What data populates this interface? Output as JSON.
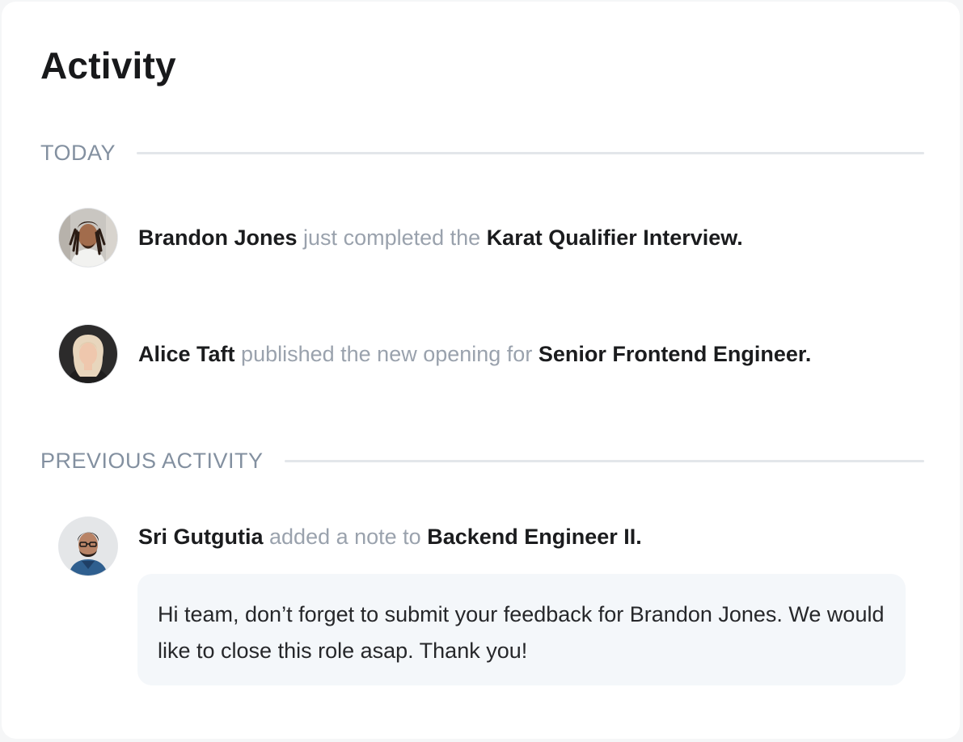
{
  "header": {
    "title": "Activity"
  },
  "sections": {
    "today": {
      "label": "TODAY",
      "items": [
        {
          "name": "Brandon Jones",
          "verb": "just completed the",
          "target": "Karat Qualifier Interview.",
          "avatar_icon": "person-photo-icon"
        },
        {
          "name": "Alice Taft",
          "verb": "published the new opening for",
          "target": "Senior Frontend Engineer.",
          "avatar_icon": "person-photo-icon"
        }
      ]
    },
    "previous": {
      "label": "PREVIOUS ACTIVITY",
      "items": [
        {
          "name": "Sri Gutgutia",
          "verb": "added a note to",
          "target": "Backend Engineer II.",
          "avatar_icon": "person-photo-icon",
          "note": "Hi team, don’t forget to submit your feedback for Brandon Jones. We would like to close this role asap. Thank you!"
        }
      ]
    }
  },
  "colors": {
    "heading": "#18191b",
    "section_label": "#8390a0",
    "verb_text": "#9aa2ad",
    "note_background": "#f4f7fa"
  }
}
